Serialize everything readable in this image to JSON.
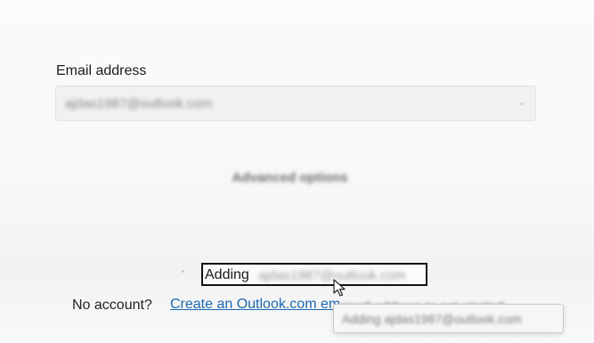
{
  "email_section": {
    "label": "Email address",
    "value": "ajdas1987@outlook.com",
    "chevron_icon": "chevron-down-icon"
  },
  "advanced_options": {
    "label": "Advanced options"
  },
  "status": {
    "adding_prefix": "Adding",
    "adding_email": "ajdas1987@outlook.com"
  },
  "footer": {
    "no_account_label": "No account?",
    "create_link_label": "Create an Outlook.com email address",
    "link_tail": "email address to get started"
  },
  "tooltip": {
    "text": "Adding ajdas1987@outlook.com"
  },
  "colors": {
    "link": "#1a68b5",
    "focus_border": "#111111"
  }
}
